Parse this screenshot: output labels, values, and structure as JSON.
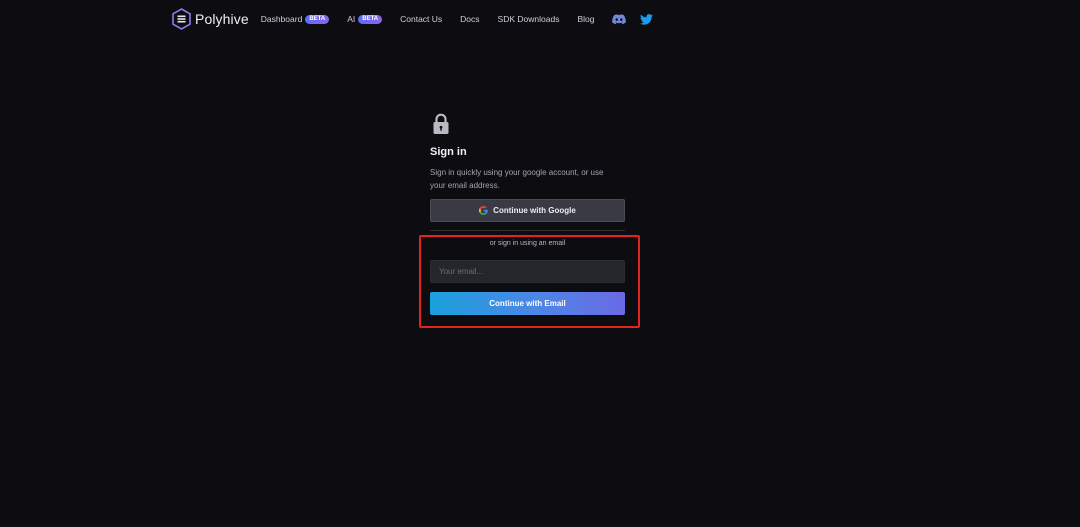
{
  "header": {
    "logo_text": "Polyhive",
    "nav": [
      {
        "label": "Dashboard",
        "badge": "BETA"
      },
      {
        "label": "AI",
        "badge": "BETA"
      },
      {
        "label": "Contact Us"
      },
      {
        "label": "Docs"
      },
      {
        "label": "SDK Downloads"
      },
      {
        "label": "Blog"
      }
    ],
    "social": [
      {
        "icon": "discord-icon",
        "color": "#7289da"
      },
      {
        "icon": "twitter-icon",
        "color": "#1d9bf0"
      }
    ]
  },
  "signin": {
    "title": "Sign in",
    "subtitle": "Sign in quickly using your google account, or use your email address.",
    "google_label": "Continue with Google",
    "or_text": "or sign in using an email",
    "email_placeholder": "Your email...",
    "email_value": "",
    "email_button_label": "Continue with Email"
  },
  "colors": {
    "background": "#0d0c10",
    "badge_gradient": [
      "#5b6cff",
      "#8a66e8"
    ],
    "email_button_gradient": [
      "#1aa0dc",
      "#6a6ae4"
    ],
    "highlight": "#e0241f"
  }
}
